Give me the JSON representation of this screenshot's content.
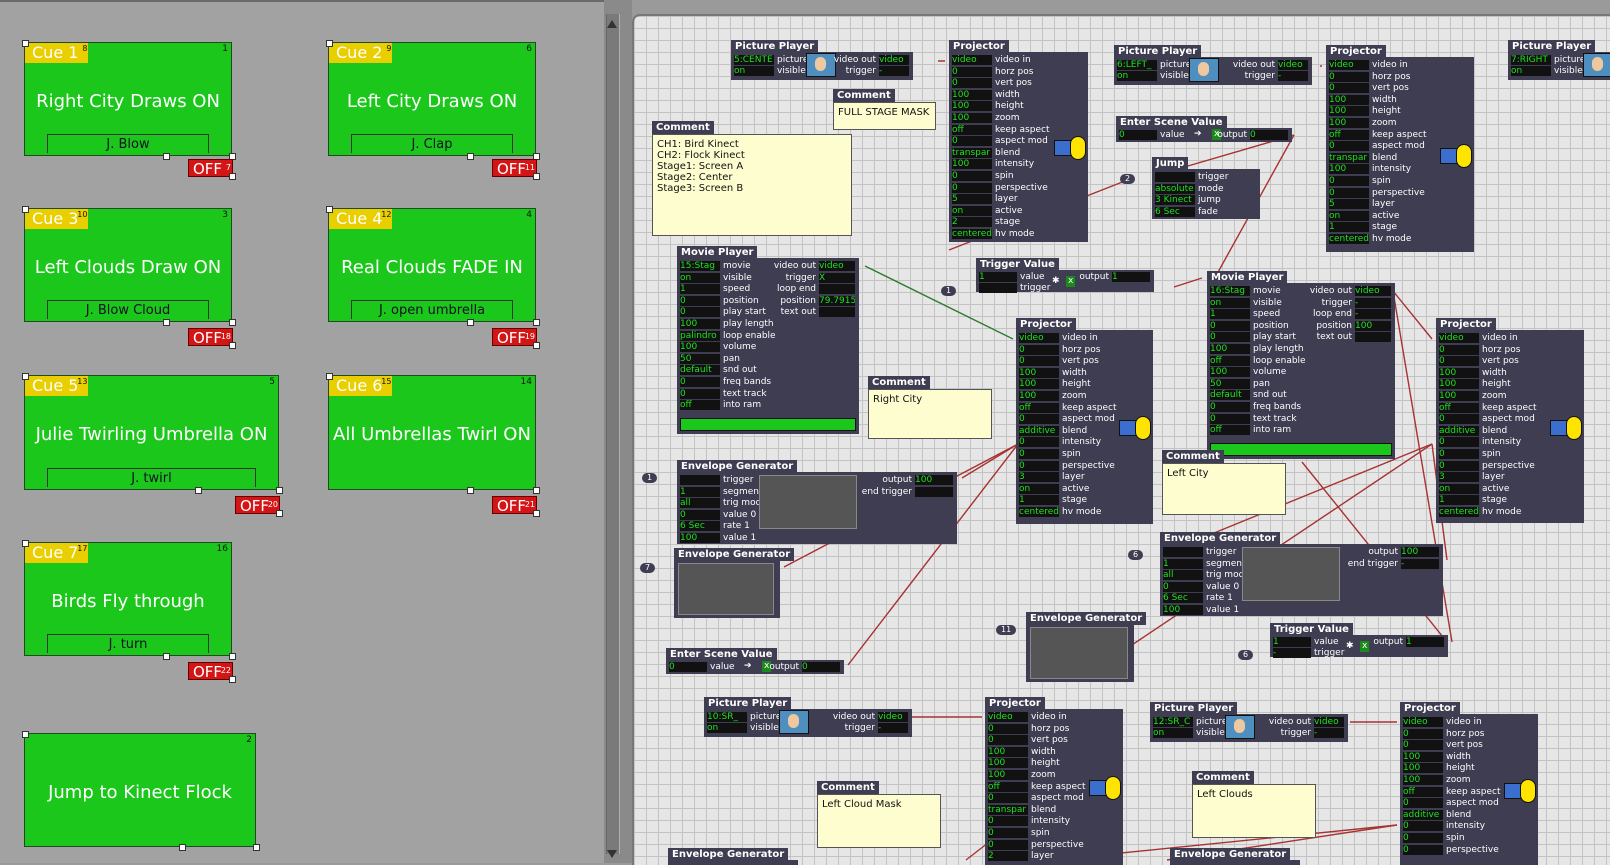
{
  "colors": {
    "cue_green": "#1cc71c",
    "cue_tag": "#e9cf00",
    "off_red": "#d31515",
    "actor_bg": "#3e3d51",
    "wire_red": "#a83232",
    "wire_green": "#2e7d2e",
    "comment_bg": "#fefdd0"
  },
  "cues": [
    {
      "tag": "Cue 1",
      "tag_num": "8",
      "num": "1",
      "title": "Right City Draws ON",
      "sub": "J. Blow",
      "off": "OFF",
      "off_num": "7"
    },
    {
      "tag": "Cue 2",
      "tag_num": "9",
      "num": "6",
      "title": "Left City Draws ON",
      "sub": "J. Clap",
      "off": "OFF",
      "off_num": "11"
    },
    {
      "tag": "Cue 3",
      "tag_num": "10",
      "num": "3",
      "title": "Left Clouds Draw ON",
      "sub": "J. Blow Cloud",
      "off": "OFF",
      "off_num": "18"
    },
    {
      "tag": "Cue 4",
      "tag_num": "12",
      "num": "4",
      "title": "Real Clouds FADE IN",
      "sub": "J. open umbrella",
      "off": "OFF",
      "off_num": "19"
    },
    {
      "tag": "Cue 5",
      "tag_num": "13",
      "num": "5",
      "title": "Julie Twirling Umbrella ON",
      "sub": "J. twirl",
      "off": "OFF",
      "off_num": "20"
    },
    {
      "tag": "Cue 6",
      "tag_num": "15",
      "num": "14",
      "title": "All Umbrellas Twirl ON",
      "sub": "",
      "off": "OFF",
      "off_num": "21"
    },
    {
      "tag": "Cue 7",
      "tag_num": "17",
      "num": "16",
      "title": "Birds Fly through",
      "sub": "J. turn",
      "off": "OFF",
      "off_num": "22"
    },
    {
      "tag": "",
      "tag_num": "",
      "num": "2",
      "title": "Jump to Kinect Flock",
      "sub": "",
      "off": "",
      "off_num": ""
    }
  ],
  "projector_labels": [
    "video in",
    "horz pos",
    "vert pos",
    "width",
    "height",
    "zoom",
    "keep aspect",
    "aspect mod",
    "blend",
    "intensity",
    "spin",
    "perspective",
    "layer",
    "active",
    "stage",
    "hv mode"
  ],
  "movie_labels": [
    "movie",
    "visible",
    "speed",
    "position",
    "play start",
    "play length",
    "loop enable",
    "volume",
    "pan",
    "snd out",
    "freq bands",
    "text track",
    "into ram"
  ],
  "movie_out_labels": [
    "video out",
    "trigger",
    "loop end",
    "position",
    "text out"
  ],
  "env_labels": [
    "trigger",
    "segments",
    "trig mode",
    "value 0",
    "rate 1",
    "value 1"
  ],
  "picture_labels": [
    "picture",
    "visible"
  ],
  "picture_out_labels": [
    "video out",
    "trigger"
  ],
  "jump_labels": [
    "trigger",
    "mode",
    "jump",
    "fade"
  ],
  "actors": {
    "pp1": {
      "title": "Picture Player",
      "vals": [
        "5:CENTE",
        "on"
      ],
      "outs": [
        "video",
        "-"
      ]
    },
    "proj1": {
      "title": "Projector",
      "vals": [
        "video",
        "0",
        "0",
        "100",
        "100",
        "100",
        "off",
        "0",
        "transpar",
        "100",
        "0",
        "0",
        "5",
        "on",
        "2",
        "centered"
      ]
    },
    "pp2": {
      "title": "Picture Player",
      "vals": [
        "6:LEFT_",
        "on"
      ],
      "outs": [
        "video",
        "-"
      ]
    },
    "proj2": {
      "title": "Projector",
      "vals": [
        "video",
        "0",
        "0",
        "100",
        "100",
        "100",
        "off",
        "0",
        "transpar",
        "100",
        "0",
        "0",
        "5",
        "on",
        "1",
        "centered"
      ]
    },
    "pp3": {
      "title": "Picture Player",
      "vals": [
        "7:RIGHT",
        "on"
      ]
    },
    "esv1": {
      "title": "Enter Scene Value",
      "val": "0",
      "val_label": "value",
      "out_label": "output",
      "out": "0"
    },
    "jump": {
      "title": "Jump",
      "vals": [
        "",
        "absolute",
        "3 Kinect",
        "6 Sec"
      ]
    },
    "movie1": {
      "title": "Movie Player",
      "vals": [
        "15:Stag",
        "on",
        "1",
        "0",
        "0",
        "100",
        "palindro",
        "100",
        "50",
        "default",
        "0",
        "0",
        "off"
      ],
      "outs": [
        "video",
        "X",
        "",
        "79.7915",
        ""
      ]
    },
    "trig1": {
      "title": "Trigger Value",
      "vals": [
        "1",
        ""
      ],
      "val_labels": [
        "value",
        "trigger"
      ],
      "out_label": "output",
      "out": "1"
    },
    "movie2": {
      "title": "Movie Player",
      "vals": [
        "16:Stag",
        "on",
        "1",
        "0",
        "0",
        "100",
        "off",
        "100",
        "50",
        "default",
        "0",
        "0",
        "off"
      ],
      "outs": [
        "video",
        "-",
        "-",
        "100",
        ""
      ]
    },
    "proj3": {
      "title": "Projector",
      "vals": [
        "video",
        "0",
        "0",
        "100",
        "100",
        "100",
        "off",
        "0",
        "additive",
        "0",
        "0",
        "0",
        "3",
        "on",
        "1",
        "centered"
      ]
    },
    "proj4": {
      "title": "Projector",
      "vals": [
        "video",
        "0",
        "0",
        "100",
        "100",
        "100",
        "off",
        "0",
        "additive",
        "0",
        "0",
        "0",
        "3",
        "on",
        "1",
        "centered"
      ]
    },
    "env1": {
      "title": "Envelope Generator",
      "vals": [
        "",
        "1",
        "all",
        "0",
        "6 Sec",
        "100"
      ],
      "out_labels": [
        "output",
        "end trigger"
      ],
      "outs": [
        "100",
        ""
      ]
    },
    "env2": {
      "title": "Envelope Generator"
    },
    "env3": {
      "title": "Envelope Generator",
      "vals": [
        "",
        "1",
        "all",
        "0",
        "6 Sec",
        "100"
      ],
      "out_labels": [
        "output",
        "end trigger"
      ],
      "outs": [
        "100",
        "-"
      ]
    },
    "env4": {
      "title": "Envelope Generator"
    },
    "trig2": {
      "title": "Trigger Value",
      "vals": [
        "1",
        "-"
      ],
      "val_labels": [
        "value",
        "trigger"
      ],
      "out_label": "output",
      "out": "1"
    },
    "esv2": {
      "title": "Enter Scene Value",
      "val": "0",
      "val_label": "value",
      "out_label": "output",
      "out": "0"
    },
    "pp4": {
      "title": "Picture Player",
      "vals": [
        "10:SR_",
        "on"
      ],
      "outs": [
        "video",
        "-"
      ]
    },
    "proj5": {
      "title": "Projector",
      "vals": [
        "video",
        "0",
        "0",
        "100",
        "100",
        "100",
        "off",
        "0",
        "transpar",
        "0",
        "0",
        "0",
        "2"
      ]
    },
    "pp5": {
      "title": "Picture Player",
      "vals": [
        "12:SR_C",
        "on"
      ],
      "outs": [
        "video",
        "-"
      ]
    },
    "proj6": {
      "title": "Projector",
      "vals": [
        "video",
        "0",
        "0",
        "100",
        "100",
        "100",
        "off",
        "0",
        "additive",
        "0",
        "0",
        "0"
      ]
    },
    "env5": {
      "title": "Envelope Generator"
    },
    "env6": {
      "title": "Envelope Generator"
    }
  },
  "comments": [
    {
      "head": "Comment",
      "text": "CH1: Bird Kinect\nCH2: Flock Kinect\nStage1: Screen A\nStage2: Center\nStage3: Screen B"
    },
    {
      "head": "Comment",
      "text": "FULL STAGE MASK"
    },
    {
      "head": "Comment",
      "text": "Right City"
    },
    {
      "head": "Comment",
      "text": "Left City"
    },
    {
      "head": "Comment",
      "text": "Left Cloud Mask"
    },
    {
      "head": "Comment",
      "text": "Left Clouds"
    }
  ],
  "badges": [
    "2",
    "1",
    "1",
    "7",
    "6",
    "11",
    "6"
  ]
}
